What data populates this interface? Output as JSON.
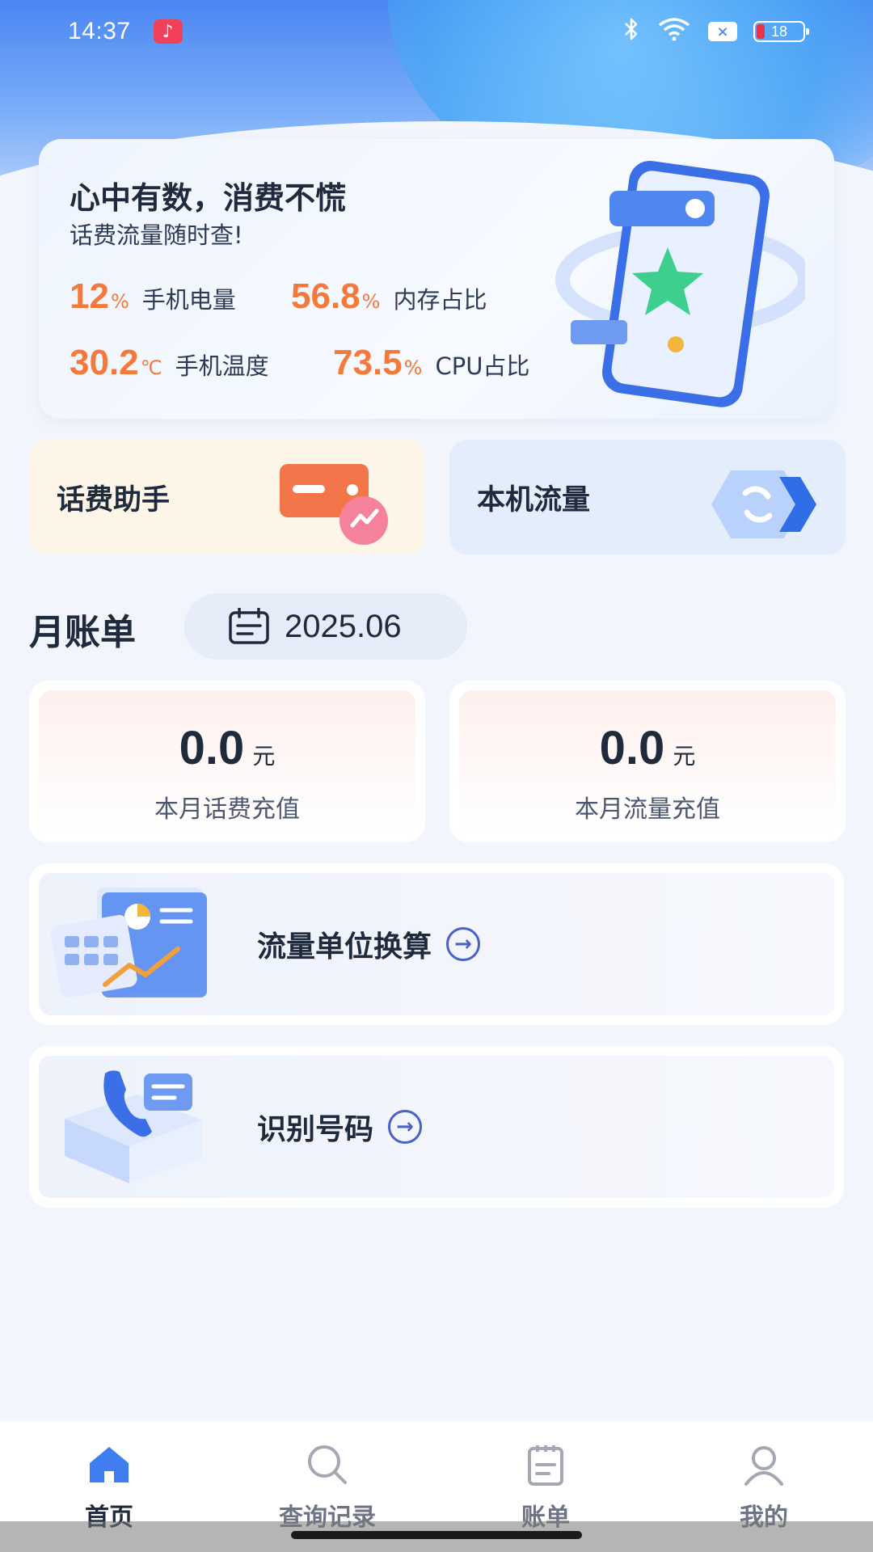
{
  "status_bar": {
    "time": "14:37",
    "battery": "18",
    "icons": [
      "music-icon",
      "bluetooth-icon",
      "wifi-icon",
      "sim-icon",
      "battery-icon"
    ]
  },
  "hero": {
    "title": "心中有数，消费不慌",
    "subtitle": "话费流量随时查!",
    "stats": [
      {
        "value": "12",
        "unit": "%",
        "label": "手机电量"
      },
      {
        "value": "56.8",
        "unit": "%",
        "label": "内存占比"
      },
      {
        "value": "30.2",
        "unit": "℃",
        "label": "手机温度"
      },
      {
        "value": "73.5",
        "unit": "%",
        "label": "CPU占比"
      }
    ]
  },
  "quick_cards": {
    "fee_assistant": "话费助手",
    "local_flow": "本机流量"
  },
  "month_bill": {
    "title": "月账单",
    "date": "2025.06",
    "cards": [
      {
        "value": "0.0",
        "unit": "元",
        "label": "本月话费充值"
      },
      {
        "value": "0.0",
        "unit": "元",
        "label": "本月流量充值"
      }
    ]
  },
  "features": [
    {
      "label": "流量单位换算"
    },
    {
      "label": "识别号码"
    }
  ],
  "bottom_nav": [
    {
      "label": "首页",
      "icon": "home-icon",
      "active": true
    },
    {
      "label": "查询记录",
      "icon": "search-icon",
      "active": false
    },
    {
      "label": "账单",
      "icon": "bill-icon",
      "active": false
    },
    {
      "label": "我的",
      "icon": "user-icon",
      "active": false
    }
  ],
  "colors": {
    "accent_orange": "#f4793a",
    "primary_blue": "#3f7df0",
    "text_dark": "#1f2a3d"
  }
}
